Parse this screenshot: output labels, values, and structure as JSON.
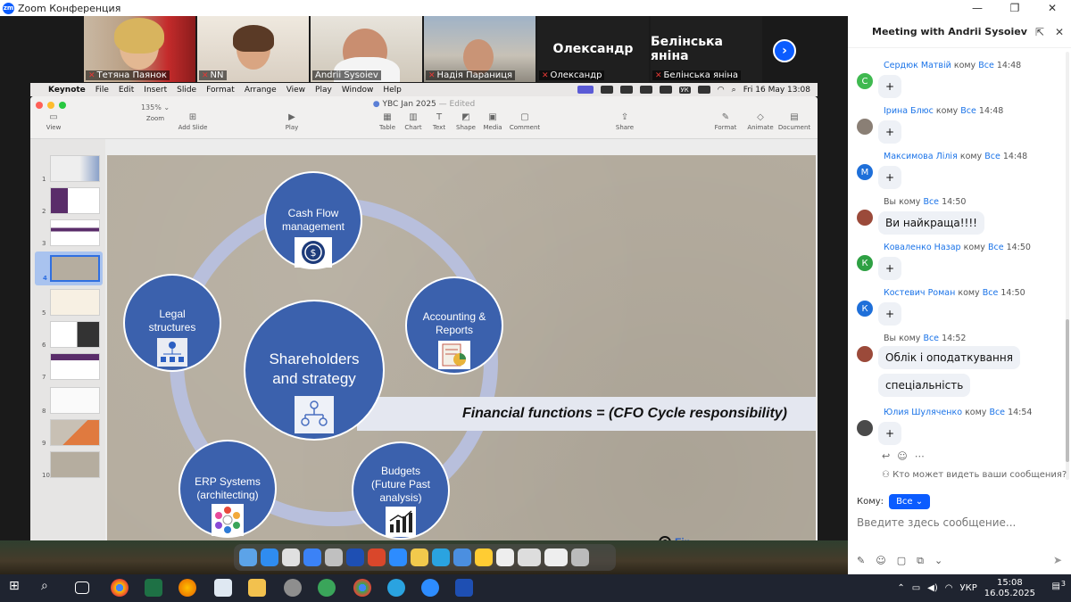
{
  "window": {
    "title": "Zoom Конференция",
    "controls": [
      "—",
      "❐",
      "✕"
    ]
  },
  "participants": [
    {
      "name": "Тетяна Паянок",
      "muted": true
    },
    {
      "name": "NN",
      "muted": true
    },
    {
      "name": "Andrii Sysoiev",
      "muted": false
    },
    {
      "name": "Надія Параниця",
      "muted": true
    },
    {
      "name": "Олександр",
      "muted": true,
      "display": "Олександр"
    },
    {
      "name": "Белінська яніна",
      "muted": true,
      "display": "Белінська яніна"
    }
  ],
  "mac_menu": {
    "app": "Keynote",
    "items": [
      "File",
      "Edit",
      "Insert",
      "Slide",
      "Format",
      "Arrange",
      "View",
      "Play",
      "Window",
      "Help"
    ],
    "lang": "УК",
    "datetime": "Fri 16 May  13:08"
  },
  "keynote": {
    "doc_title": "YBC Jan 2025",
    "doc_status": "Edited",
    "zoom": "135%",
    "tools": [
      "View",
      "Zoom",
      "Add Slide",
      "Play",
      "Table",
      "Chart",
      "Text",
      "Shape",
      "Media",
      "Comment",
      "Share",
      "Format",
      "Animate",
      "Document"
    ],
    "slide_numbers": [
      "1",
      "2",
      "3",
      "4",
      "5",
      "6",
      "7",
      "8",
      "9",
      "10"
    ],
    "selected_slide": 4
  },
  "slide": {
    "nodes": {
      "cash_flow": "Cash Flow management",
      "accounting": "Accounting & Reports",
      "budgets": "Budgets (Future Past analysis)",
      "erp": "ERP Systems (architecting)",
      "legal": "Legal structures",
      "center": "Shareholders and strategy"
    },
    "banner": "Financial functions = (CFO Cycle responsibility)",
    "logo_text": "Fin"
  },
  "chat": {
    "title": "Meeting with Andrii Sysoiev",
    "messages": [
      {
        "sender": "Сердюк Матвій",
        "to_word": "кому",
        "to": "Все",
        "time": "14:48",
        "text": "+",
        "avatar": "С",
        "avatar_color": "#3fb950"
      },
      {
        "sender": "Ірина Блюс",
        "to_word": "кому",
        "to": "Все",
        "time": "14:48",
        "text": "+",
        "avatar": "",
        "avatar_color": "#8a7f75"
      },
      {
        "sender": "Максимова Лілія",
        "to_word": "кому",
        "to": "Все",
        "time": "14:48",
        "text": "+",
        "avatar": "М",
        "avatar_color": "#1e6fd9"
      },
      {
        "sender": "Вы",
        "to_word": "кому",
        "to": "Все",
        "time": "14:50",
        "text": "Ви найкраща!!!!",
        "avatar": "",
        "avatar_color": "#9b4a3a"
      },
      {
        "sender": "Коваленко Назар",
        "to_word": "кому",
        "to": "Все",
        "time": "14:50",
        "text": "+",
        "avatar": "К",
        "avatar_color": "#2ea043"
      },
      {
        "sender": "Костевич Роман",
        "to_word": "кому",
        "to": "Все",
        "time": "14:50",
        "text": "+",
        "avatar": "К",
        "avatar_color": "#1e6fd9"
      },
      {
        "sender": "Вы",
        "to_word": "кому",
        "to": "Все",
        "time": "14:52",
        "text": "Облік і оподаткування",
        "text2": "спеціальність",
        "avatar": "",
        "avatar_color": "#9b4a3a"
      },
      {
        "sender": "Юлия Шуляченко",
        "to_word": "кому",
        "to": "Все",
        "time": "14:54",
        "text": "+",
        "avatar": "",
        "avatar_color": "#4a4a4a"
      }
    ],
    "who_can_see": "Кто может видеть ваши сообщения?",
    "to_label": "Кому:",
    "to_value": "Все",
    "input_placeholder": "Введите здесь сообщение..."
  },
  "taskbar": {
    "lang": "УКР",
    "time": "15:08",
    "date": "16.05.2025",
    "notif": "3"
  }
}
